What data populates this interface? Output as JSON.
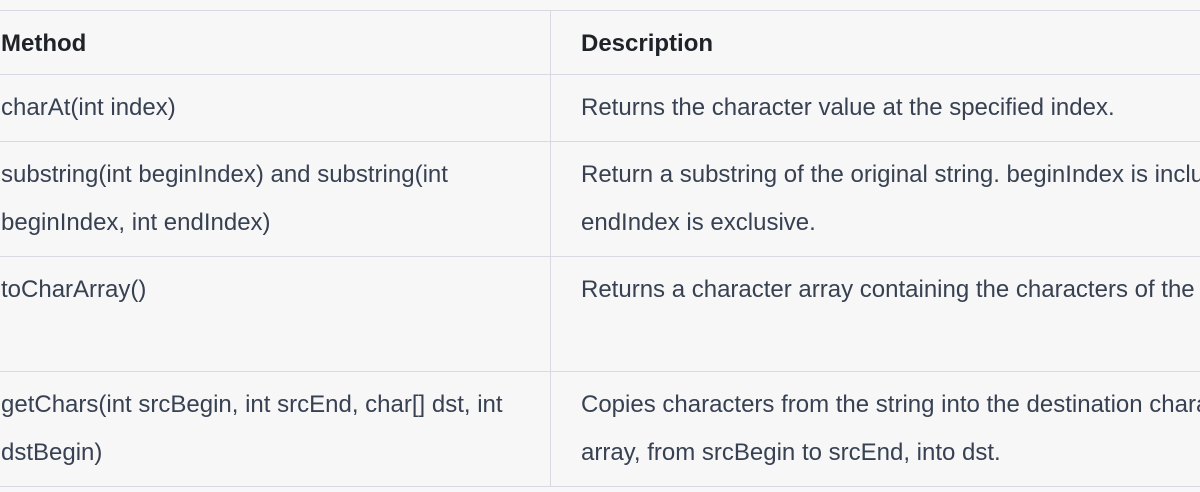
{
  "table": {
    "headers": [
      "Method",
      "Description"
    ],
    "rows": [
      {
        "method": "charAt(int index)",
        "description": "Returns the character value at the specified index."
      },
      {
        "method": "substring(int beginIndex) and substring(int beginIndex, int endIndex)",
        "description": "Return a substring of the original string. beginIndex is inclusive, endIndex is exclusive."
      },
      {
        "method": "toCharArray()",
        "description": "Returns a character array containing the characters of the string."
      },
      {
        "method": "getChars(int srcBegin, int srcEnd, char[] dst, int dstBegin)",
        "description": "Copies characters from the string into the destination character array, from srcBegin to srcEnd, into dst."
      }
    ]
  }
}
